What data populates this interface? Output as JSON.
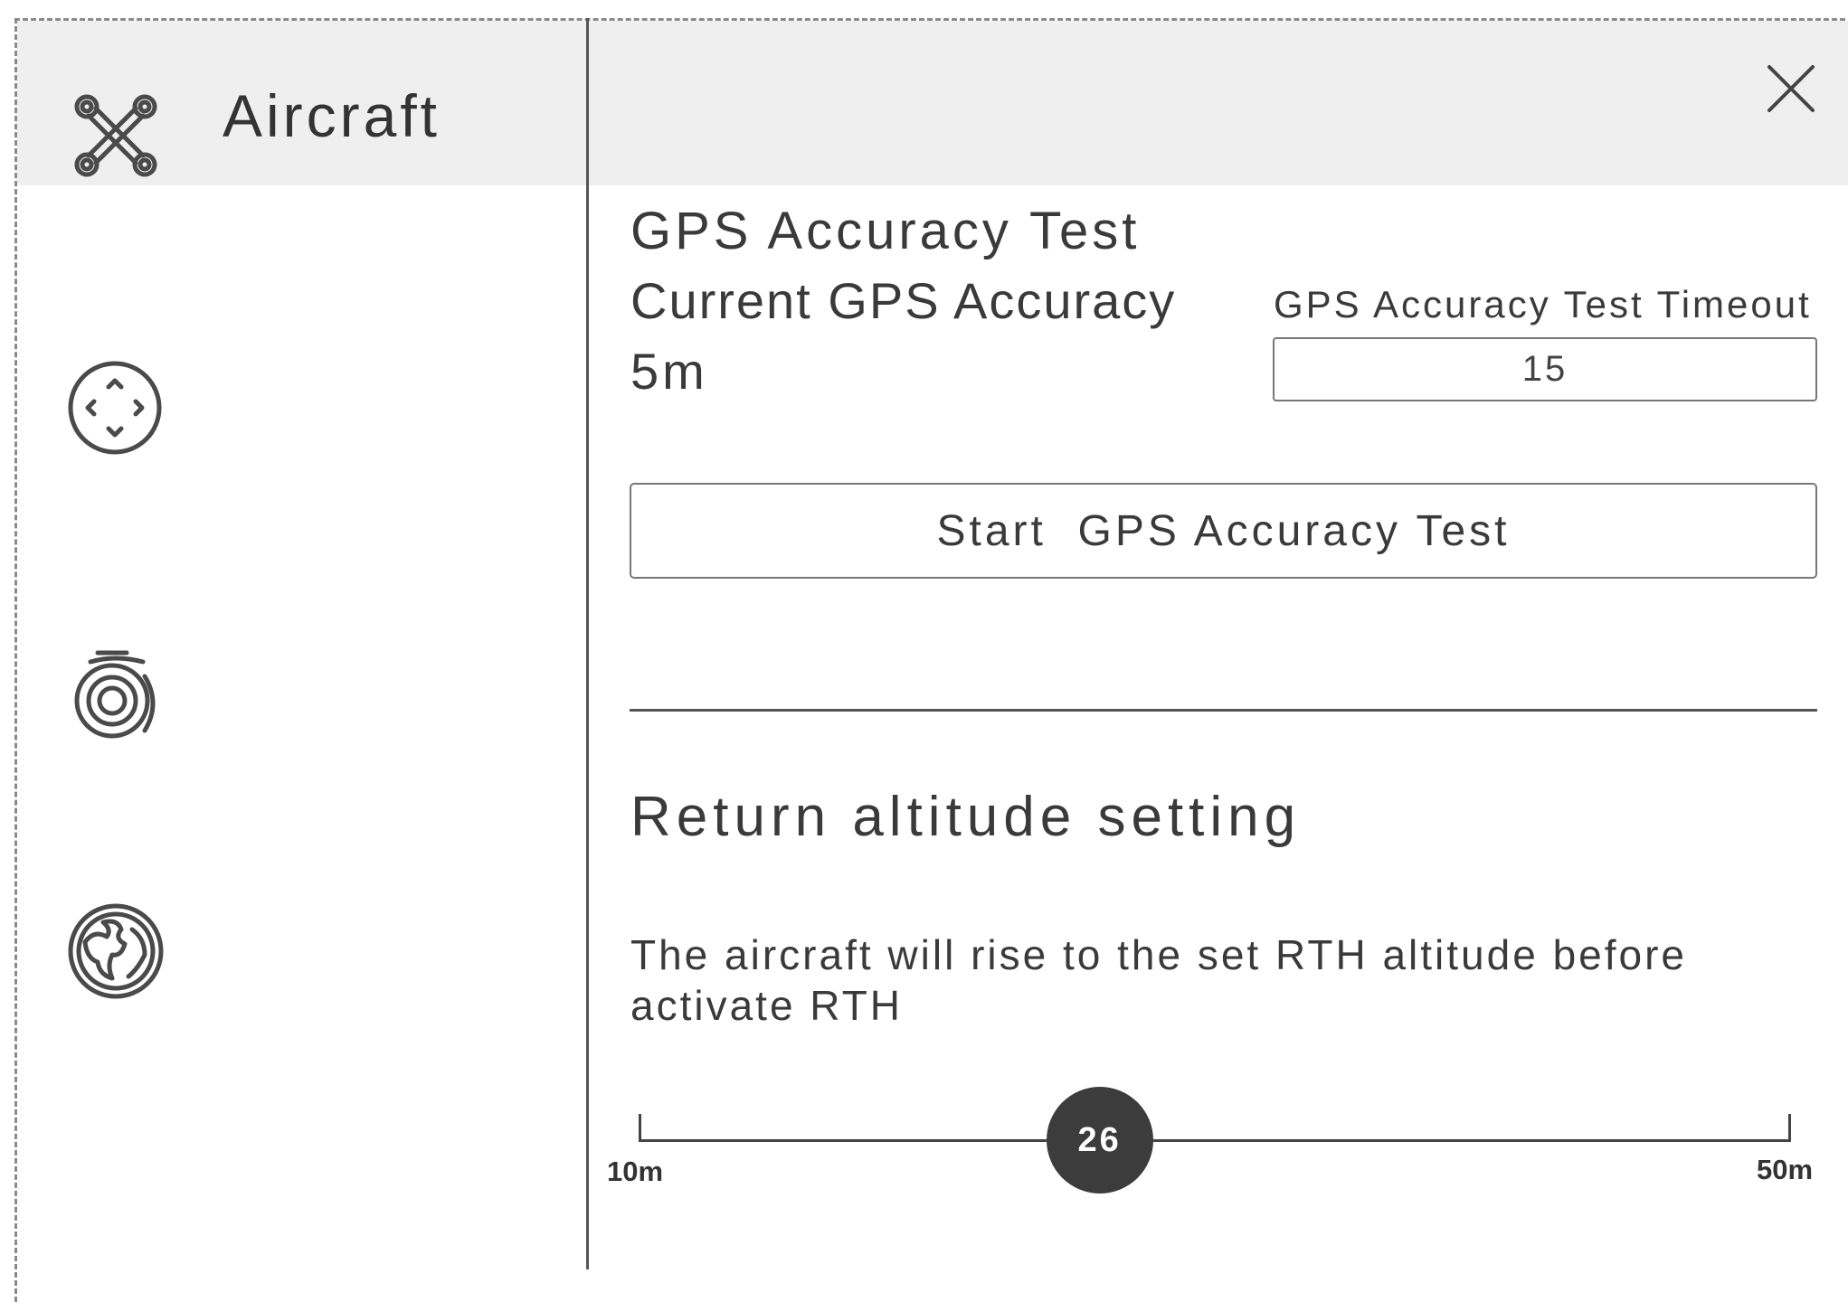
{
  "sidebar": {
    "title": "Aircraft",
    "icons": [
      "aircraft-icon",
      "joystick-icon",
      "camera-gimbal-icon",
      "globe-icon"
    ]
  },
  "gps": {
    "title": "GPS Accuracy Test",
    "current_label": "Current GPS Accuracy",
    "current_value": "5m",
    "timeout_label": "GPS Accuracy Test Timeout",
    "timeout_value": "15",
    "start_button": "Start  GPS Accuracy Test"
  },
  "rth": {
    "title": "Return altitude setting",
    "description": "The aircraft will rise to the set RTH altitude before activate RTH",
    "slider": {
      "value": "26",
      "min_label": "10m",
      "max_label": "50m",
      "fraction": 0.4
    }
  }
}
